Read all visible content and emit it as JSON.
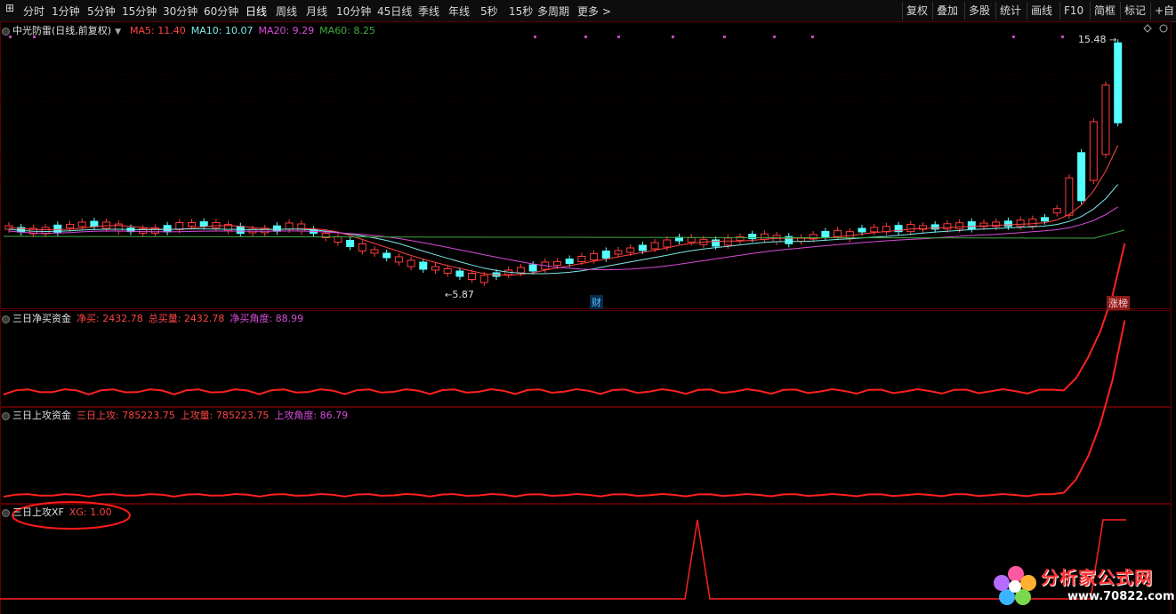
{
  "toolbar": {
    "periods": [
      "分时",
      "1分钟",
      "5分钟",
      "15分钟",
      "30分钟",
      "60分钟",
      "日线",
      "周线",
      "月线",
      "10分钟",
      "45日线",
      "季线",
      "年线",
      "5秒",
      "15秒",
      "多周期",
      "更多 >"
    ],
    "active_period": "日线",
    "right_buttons": [
      "复权",
      "叠加",
      "多股",
      "统计",
      "画线",
      "F10",
      "简框",
      "标记",
      "+自"
    ]
  },
  "main_panel": {
    "stock_name": "中光防雷(日线,前复权)",
    "indicators": [
      {
        "label": "MA5: 11.40",
        "color": "#ff4444"
      },
      {
        "label": "MA10: 10.07",
        "color": "#7fe8e8"
      },
      {
        "label": "MA20: 9.29",
        "color": "#d84cd8"
      },
      {
        "label": "MA60: 8.25",
        "color": "#3fa83f"
      }
    ],
    "high_label": "15.48",
    "low_label": "5.87",
    "cai_marker": "财",
    "zhangting_marker": "涨榜",
    "colors": {
      "up": "#ff3c3c",
      "down": "#54ffff",
      "ma5": "#ff4444",
      "ma10": "#7fe8e8",
      "ma20": "#d84cd8",
      "ma60": "#3fa83f"
    }
  },
  "panel2": {
    "title": "三日净买资金",
    "indicators": [
      {
        "label": "净买: 2432.78",
        "color": "#ff4444"
      },
      {
        "label": "总买量: 2432.78",
        "color": "#ff4444"
      },
      {
        "label": "净买角度: 88.99",
        "color": "#d84cd8"
      }
    ]
  },
  "panel3": {
    "title": "三日上攻资金",
    "indicators": [
      {
        "label": "三日上攻: 785223.75",
        "color": "#ff4444"
      },
      {
        "label": "上攻量: 785223.75",
        "color": "#ff4444"
      },
      {
        "label": "上攻角度: 86.79",
        "color": "#d84cd8"
      }
    ]
  },
  "panel4": {
    "title": "三日上攻XF",
    "indicators": [
      {
        "label": "XG: 1.00",
        "color": "#ff4444"
      }
    ]
  },
  "logo": {
    "text": "分析家公式网",
    "url": "www.70822.com"
  }
}
